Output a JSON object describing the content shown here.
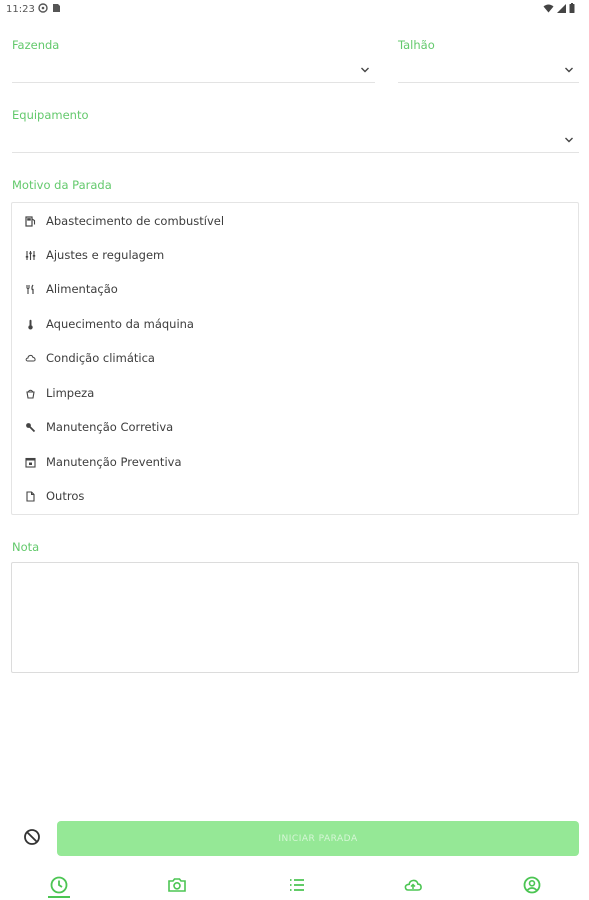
{
  "status_bar": {
    "time": "11:23",
    "left_icons": [
      "sync-icon",
      "sim-card-icon"
    ],
    "right_icons": [
      "wifi-icon",
      "signal-icon",
      "battery-icon"
    ]
  },
  "form": {
    "farm": {
      "label": "Fazenda",
      "value": ""
    },
    "plot": {
      "label": "Talhão",
      "value": ""
    },
    "equipment": {
      "label": "Equipamento",
      "value": ""
    },
    "stop_reason": {
      "label": "Motivo da Parada",
      "options": [
        {
          "label": "Abastecimento de combustível",
          "icon": "fuel-pump-icon"
        },
        {
          "label": "Ajustes e regulagem",
          "icon": "sliders-icon"
        },
        {
          "label": "Alimentação",
          "icon": "utensils-icon"
        },
        {
          "label": "Aquecimento da máquina",
          "icon": "thermometer-icon"
        },
        {
          "label": "Condição climática",
          "icon": "cloud-icon"
        },
        {
          "label": "Limpeza",
          "icon": "bucket-icon"
        },
        {
          "label": "Manutenção Corretiva",
          "icon": "wrench-icon"
        },
        {
          "label": "Manutenção Preventiva",
          "icon": "calendar-icon"
        },
        {
          "label": "Outros",
          "icon": "document-icon"
        }
      ]
    },
    "note": {
      "label": "Nota",
      "value": ""
    }
  },
  "actions": {
    "start_label": "INICIAR PARADA",
    "cancel_icon": "block-icon"
  },
  "bottom_nav": {
    "items": [
      "clock-icon",
      "camera-icon",
      "list-icon",
      "cloud-upload-icon",
      "account-circle-icon"
    ],
    "active": "clock-icon"
  },
  "colors": {
    "accent": "#63c96c",
    "button_bg": "#95e896",
    "nav_icon": "#4cc553"
  }
}
